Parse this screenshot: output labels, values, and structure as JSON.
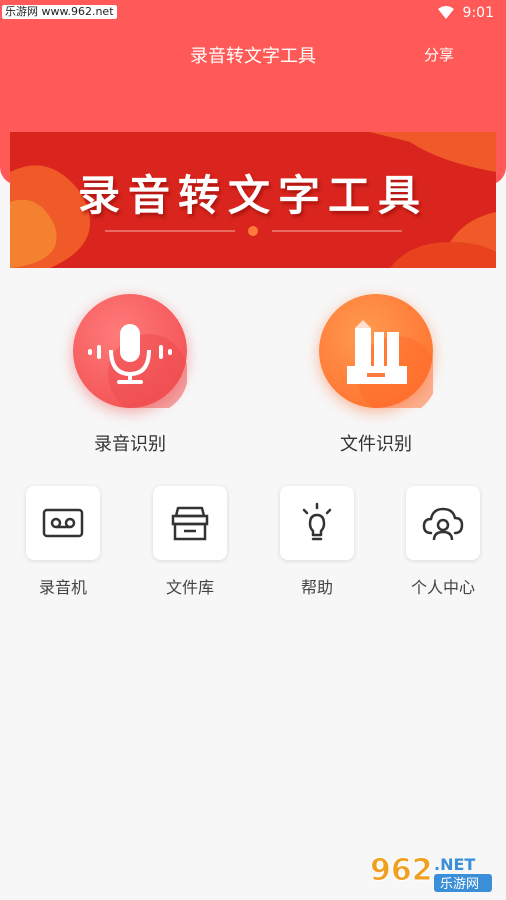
{
  "status_bar": {
    "watermark": "乐游网 www.962.net",
    "time": "9:01",
    "wifi_icon": "wifi-icon"
  },
  "header": {
    "title": "录音转文字工具",
    "share_label": "分享",
    "color": "#ff5a57"
  },
  "banner": {
    "title": "录音转文字工具"
  },
  "main_actions": [
    {
      "label": "录音识别",
      "icon": "microphone-icon",
      "color": "#f25a5a"
    },
    {
      "label": "文件识别",
      "icon": "document-folder-icon",
      "color": "#ff7a3c"
    }
  ],
  "tools": [
    {
      "label": "录音机",
      "icon": "cassette-icon"
    },
    {
      "label": "文件库",
      "icon": "archive-box-icon"
    },
    {
      "label": "帮助",
      "icon": "lightbulb-icon"
    },
    {
      "label": "个人中心",
      "icon": "user-cloud-icon"
    }
  ],
  "watermark_bottom": {
    "number": "962",
    "suffix": ".NET",
    "sub": "乐游网"
  }
}
